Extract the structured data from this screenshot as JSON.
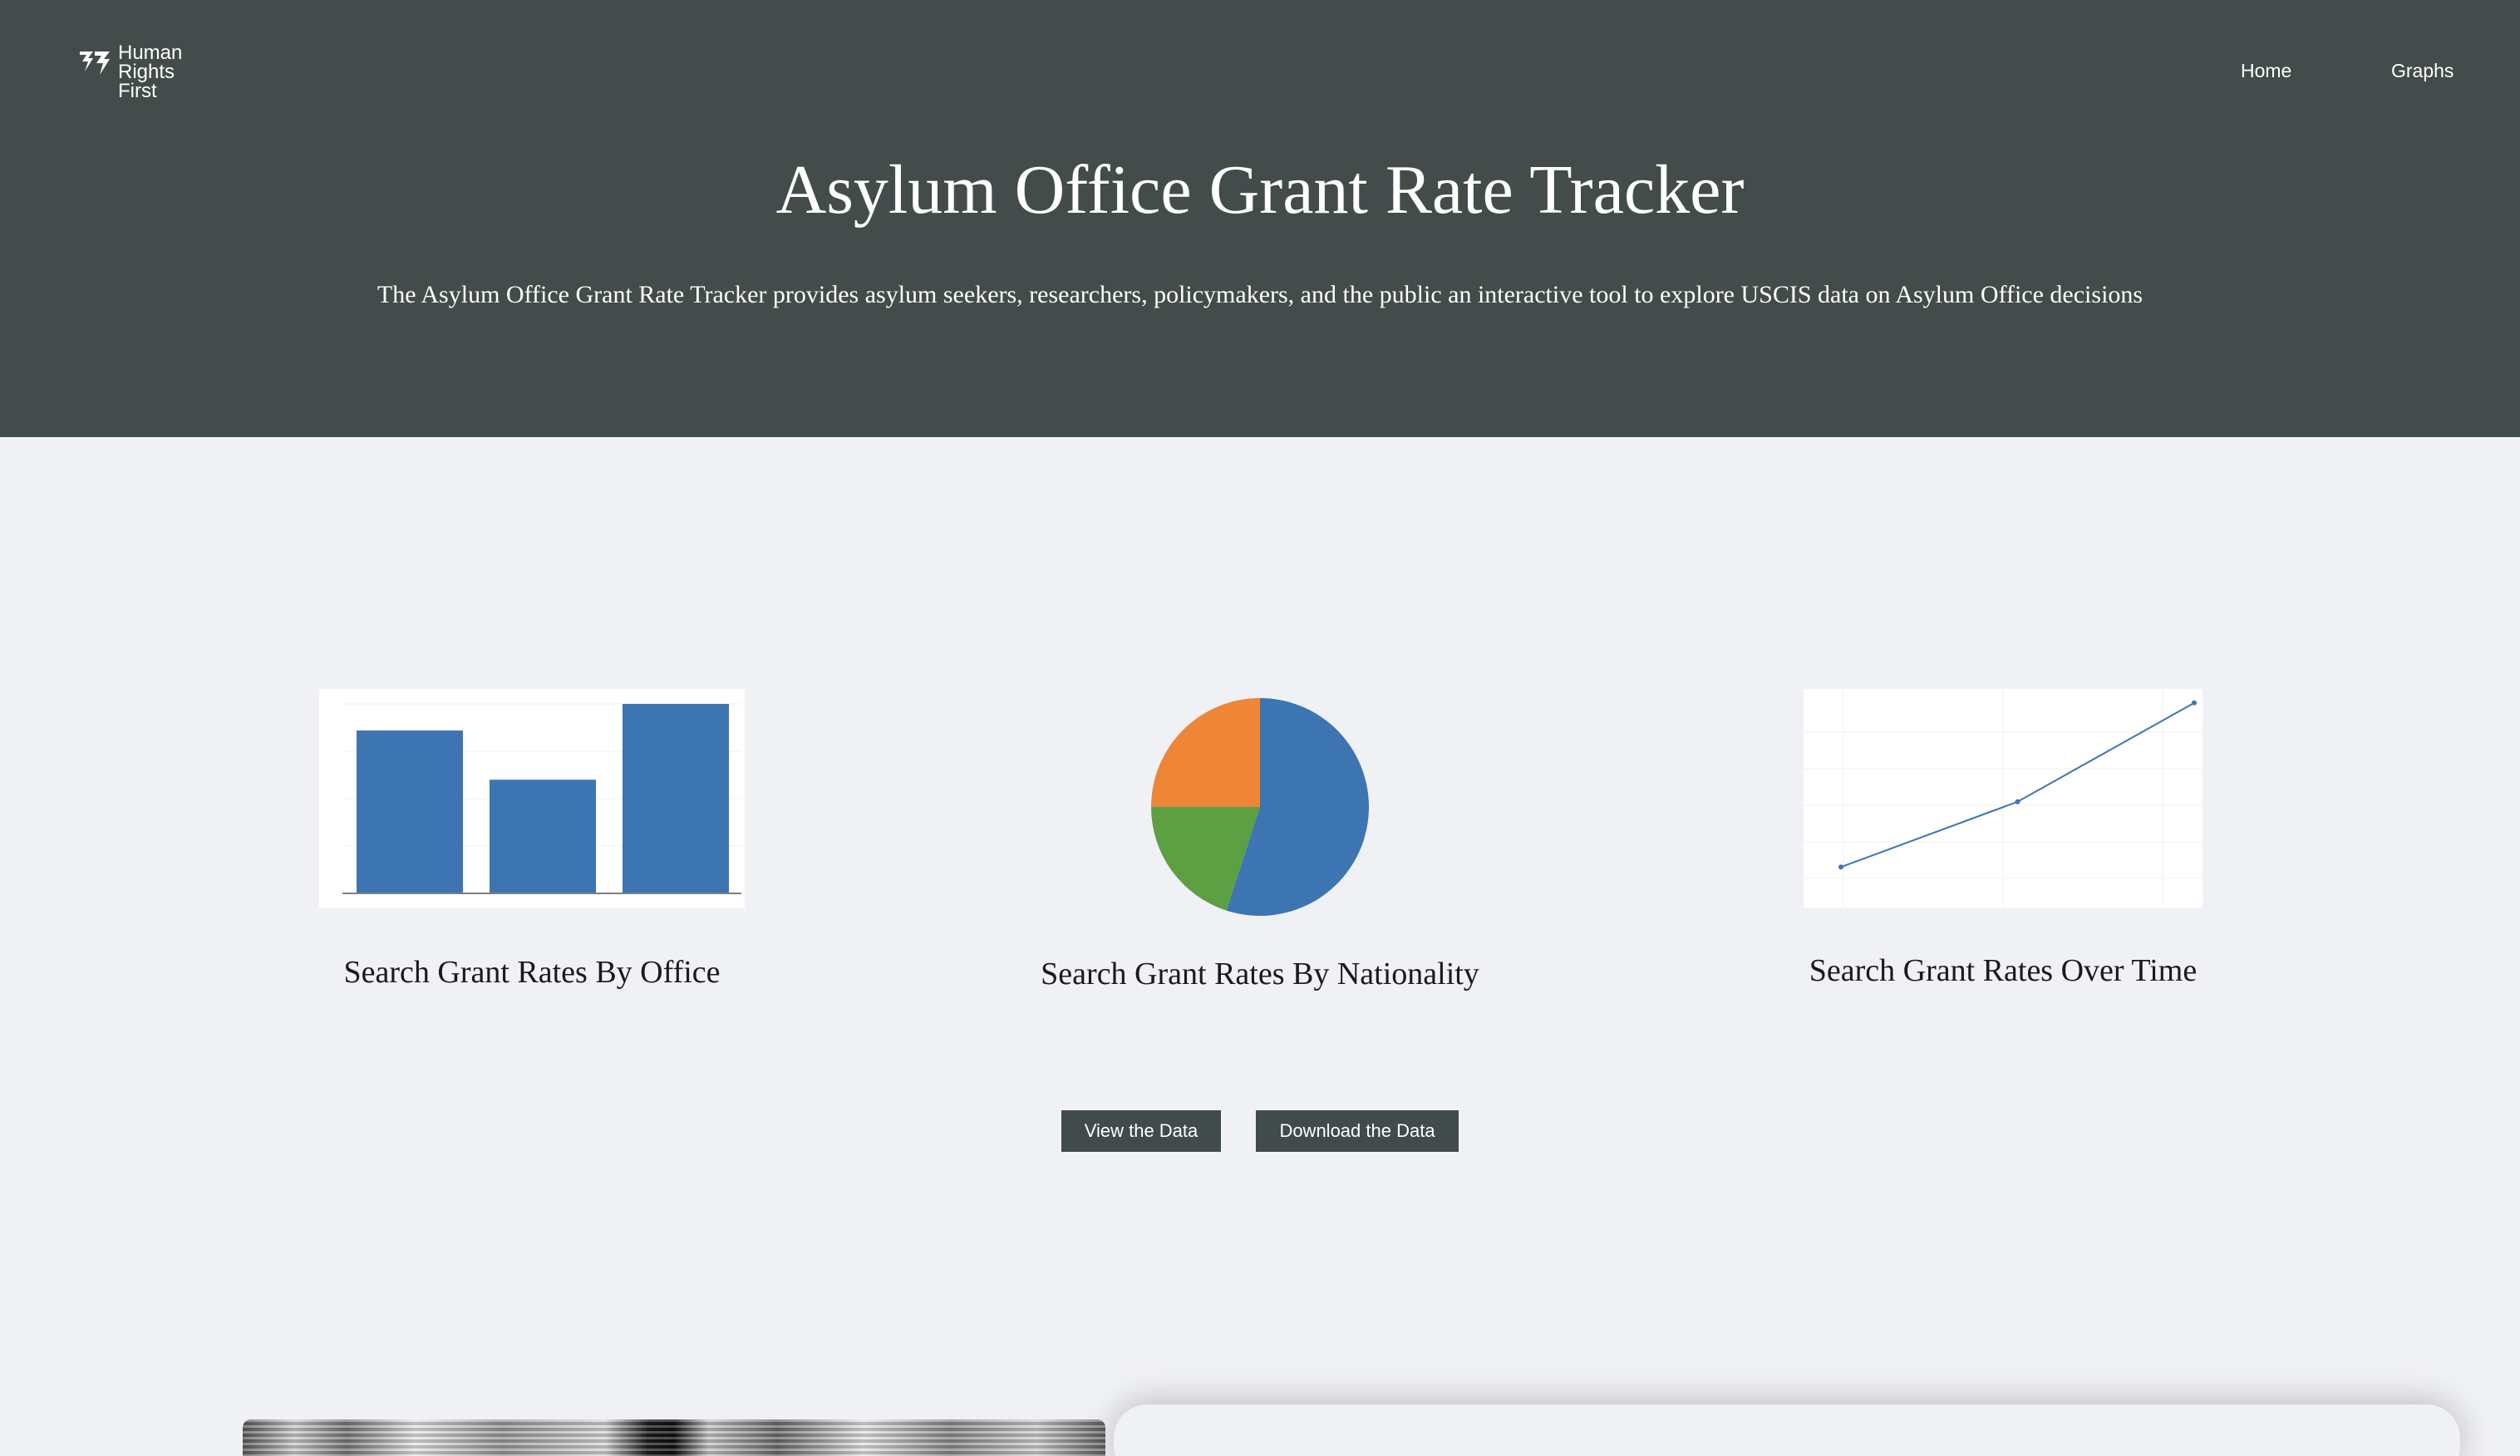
{
  "brand": {
    "logo_lines": [
      "Human",
      "Rights",
      "First"
    ],
    "header_color": "#434b4b"
  },
  "nav": {
    "home": "Home",
    "graphs": "Graphs"
  },
  "hero": {
    "title": "Asylum Office Grant Rate Tracker",
    "description": "The Asylum Office Grant Rate Tracker provides asylum seekers, researchers, policymakers, and the public an interactive tool to explore USCIS data on Asylum Office decisions"
  },
  "cards": [
    {
      "label": "Search Grant Rates By Office",
      "icon": "bar-chart-icon"
    },
    {
      "label": "Search Grant Rates By Nationality",
      "icon": "pie-chart-icon"
    },
    {
      "label": "Search Grant Rates Over Time",
      "icon": "line-chart-icon"
    }
  ],
  "buttons": {
    "view": "View the Data",
    "download": "Download the Data"
  },
  "colors": {
    "blue": "#3d75b3",
    "orange": "#ee8537",
    "green": "#5d9f43",
    "page_bg": "#f0f1f5",
    "button_bg": "#424b4b"
  },
  "chart_data": [
    {
      "type": "bar",
      "categories": [
        "",
        "",
        ""
      ],
      "values": [
        0.86,
        0.6,
        1.0
      ]
    },
    {
      "type": "pie",
      "values": [
        0.55,
        0.2,
        0.25
      ],
      "colors": [
        "#3d75b3",
        "#5d9f43",
        "#ee8537"
      ]
    },
    {
      "type": "line",
      "x": [
        0,
        1,
        2
      ],
      "values": [
        0.15,
        0.48,
        0.98
      ]
    }
  ]
}
